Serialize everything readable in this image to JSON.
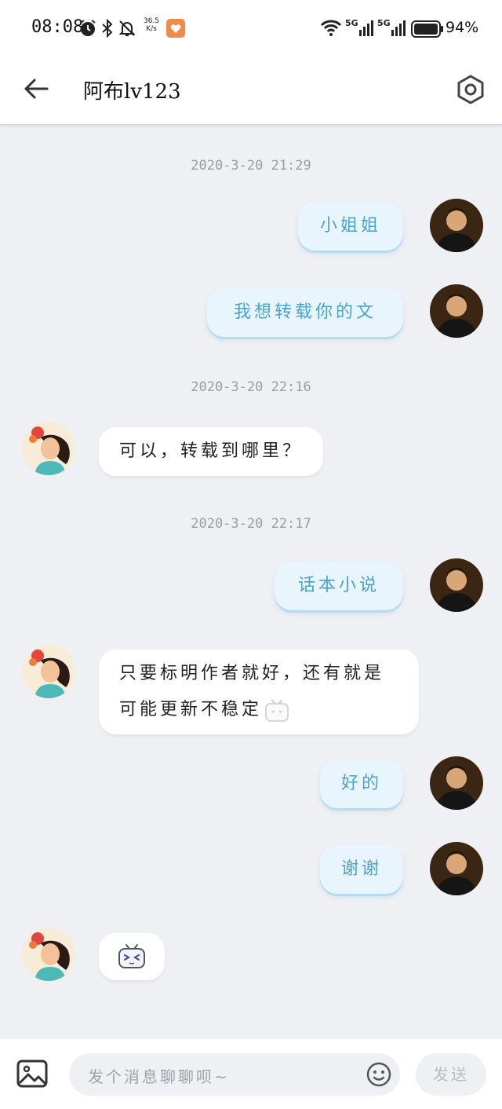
{
  "status_bar": {
    "time": "08:08",
    "net_speed_value": "36.5",
    "net_speed_unit": "K/s",
    "battery": "94%",
    "icons": [
      "alarm-icon",
      "bluetooth-icon",
      "mute-icon",
      "app-icon",
      "wifi-icon",
      "signal-5g-icon",
      "signal-5g-icon",
      "battery-icon"
    ]
  },
  "header": {
    "title": "阿布lv123",
    "back_icon": "arrow-left-icon",
    "settings_icon": "hexagon-gear-icon"
  },
  "messages": [
    {
      "type": "timestamp",
      "text": "2020-3-20 21:29"
    },
    {
      "type": "outgoing",
      "text": "小姐姐"
    },
    {
      "type": "outgoing",
      "text": "我想转载你的文"
    },
    {
      "type": "timestamp",
      "text": "2020-3-20 22:16"
    },
    {
      "type": "incoming",
      "text": "可以，转载到哪里？"
    },
    {
      "type": "timestamp",
      "text": "2020-3-20 22:17"
    },
    {
      "type": "outgoing",
      "text": "话本小说"
    },
    {
      "type": "incoming",
      "text": "只要标明作者就好，还有就是可能更新不稳定",
      "sticker": "tv-face-sticker"
    },
    {
      "type": "outgoing",
      "text": "好的"
    },
    {
      "type": "outgoing",
      "text": "谢谢"
    },
    {
      "type": "incoming_sticker",
      "sticker": "tv-face-squint-sticker"
    }
  ],
  "input": {
    "placeholder": "发个消息聊聊呗~",
    "send_label": "发送",
    "image_icon": "image-icon",
    "emoji_icon": "emoji-icon"
  },
  "colors": {
    "background": "#eef0f3",
    "outgoing_bubble": "#e9f5fc",
    "outgoing_text": "#4aa3cf",
    "incoming_bubble": "#ffffff",
    "timestamp": "#9a9ca1"
  }
}
